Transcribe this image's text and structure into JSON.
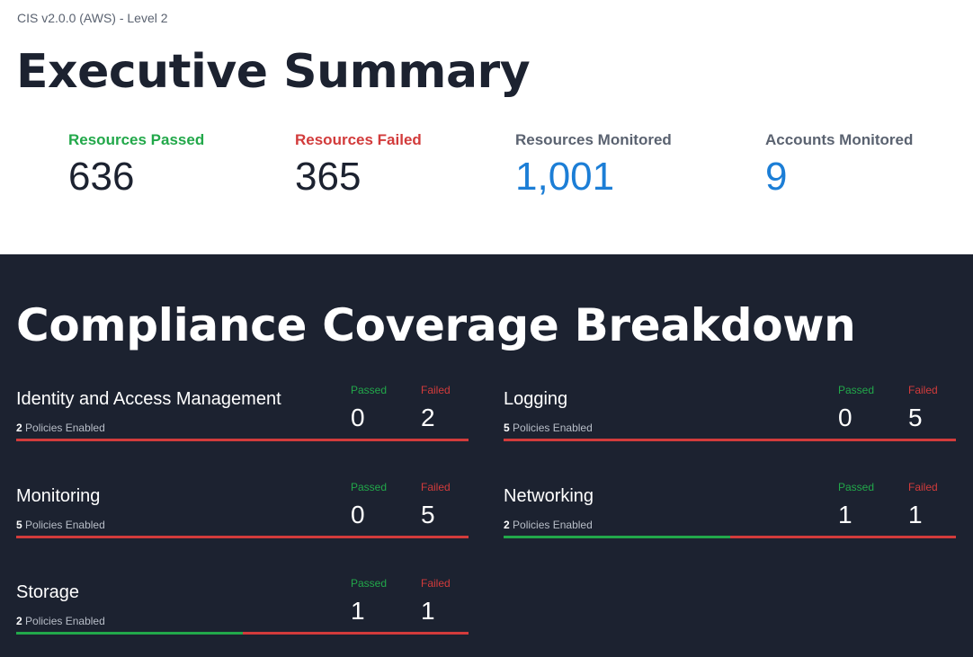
{
  "header": {
    "breadcrumb": "CIS v2.0.0 (AWS) - Level 2",
    "title": "Executive Summary"
  },
  "summary": {
    "passed": {
      "label": "Resources Passed",
      "value": "636"
    },
    "failed": {
      "label": "Resources Failed",
      "value": "365"
    },
    "monitored": {
      "label": "Resources Monitored",
      "value": "1,001"
    },
    "accounts": {
      "label": "Accounts Monitored",
      "value": "9"
    }
  },
  "coverage": {
    "title": "Compliance Coverage Breakdown",
    "passed_label": "Passed",
    "failed_label": "Failed",
    "policies_suffix": "Policies Enabled",
    "colors": {
      "pass": "#22a84a",
      "fail": "#d23b3b"
    },
    "categories": [
      {
        "name": "Identity and Access Management",
        "policies": "2",
        "passed": 0,
        "failed": 2
      },
      {
        "name": "Logging",
        "policies": "5",
        "passed": 0,
        "failed": 5
      },
      {
        "name": "Monitoring",
        "policies": "5",
        "passed": 0,
        "failed": 5
      },
      {
        "name": "Networking",
        "policies": "2",
        "passed": 1,
        "failed": 1
      },
      {
        "name": "Storage",
        "policies": "2",
        "passed": 1,
        "failed": 1
      }
    ]
  }
}
